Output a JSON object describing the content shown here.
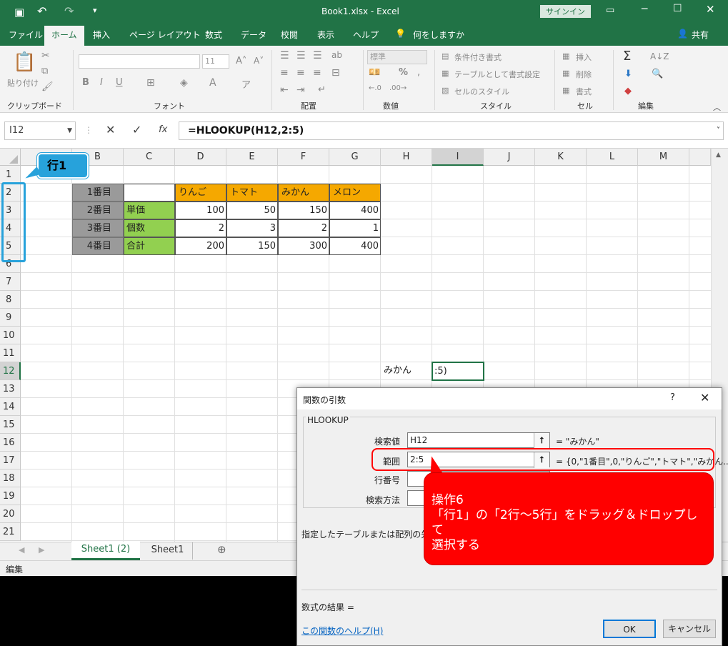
{
  "window": {
    "title": "Book1.xlsx  -  Excel",
    "signin": "サインイン"
  },
  "tabs": [
    "ファイル",
    "ホーム",
    "挿入",
    "ページ レイアウト",
    "数式",
    "データ",
    "校閲",
    "表示",
    "ヘルプ",
    "何をしますか"
  ],
  "share": "共有",
  "ribbon": {
    "groups": [
      "クリップボード",
      "フォント",
      "配置",
      "数値",
      "スタイル",
      "セル",
      "編集"
    ],
    "paste": "貼り付け",
    "font_size": "11",
    "number_format": "標準",
    "styles": [
      "条件付き書式",
      "テーブルとして書式設定",
      "セルのスタイル"
    ],
    "cells": [
      "挿入",
      "削除",
      "書式"
    ]
  },
  "formula_bar": {
    "name_box": "I12",
    "formula": "=HLOOKUP(H12,2:5)",
    "fx": "fx"
  },
  "columns": [
    "B",
    "C",
    "D",
    "E",
    "F",
    "G",
    "H",
    "I",
    "J",
    "K",
    "L",
    "M"
  ],
  "rows": [
    "1",
    "2",
    "3",
    "4",
    "5",
    "6",
    "7",
    "8",
    "9",
    "10",
    "11",
    "12",
    "13",
    "14",
    "15",
    "16",
    "17",
    "18",
    "19",
    "20",
    "21"
  ],
  "table": {
    "row_labels": [
      "1番目",
      "2番目",
      "3番目",
      "4番目"
    ],
    "headers": [
      "りんご",
      "トマト",
      "みかん",
      "メロン"
    ],
    "item_labels": [
      "単価",
      "個数",
      "合計"
    ],
    "values": [
      [
        "100",
        "50",
        "150",
        "400"
      ],
      [
        "2",
        "3",
        "2",
        "1"
      ],
      [
        "200",
        "150",
        "300",
        "400"
      ]
    ]
  },
  "cells": {
    "H12": "みかん",
    "I12": ":5)"
  },
  "sheets": [
    "Sheet1 (2)",
    "Sheet1"
  ],
  "status": "編集",
  "dialog": {
    "title": "関数の引数",
    "help": "?",
    "function": "HLOOKUP",
    "args": [
      {
        "label": "検索値",
        "value": "H12",
        "result": "= \"みかん\""
      },
      {
        "label": "範囲",
        "value": "2:5",
        "result": "= {0,\"1番目\",0,\"りんご\",\"トマト\",\"みかん..."
      },
      {
        "label": "行番号",
        "value": "",
        "result": ""
      },
      {
        "label": "検索方法",
        "value": "",
        "result": ""
      }
    ],
    "description": "指定したテーブルまたは配列の先頭行",
    "result_label": "数式の結果 =",
    "help_link": "この関数のヘルプ(H)",
    "ok": "OK",
    "cancel": "キャンセル"
  },
  "callouts": {
    "row1": "行1",
    "step_title": "操作6",
    "step_line1": "「行1」の「2行～5行」をドラッグ＆ドロップして",
    "step_line2": "選択する"
  }
}
